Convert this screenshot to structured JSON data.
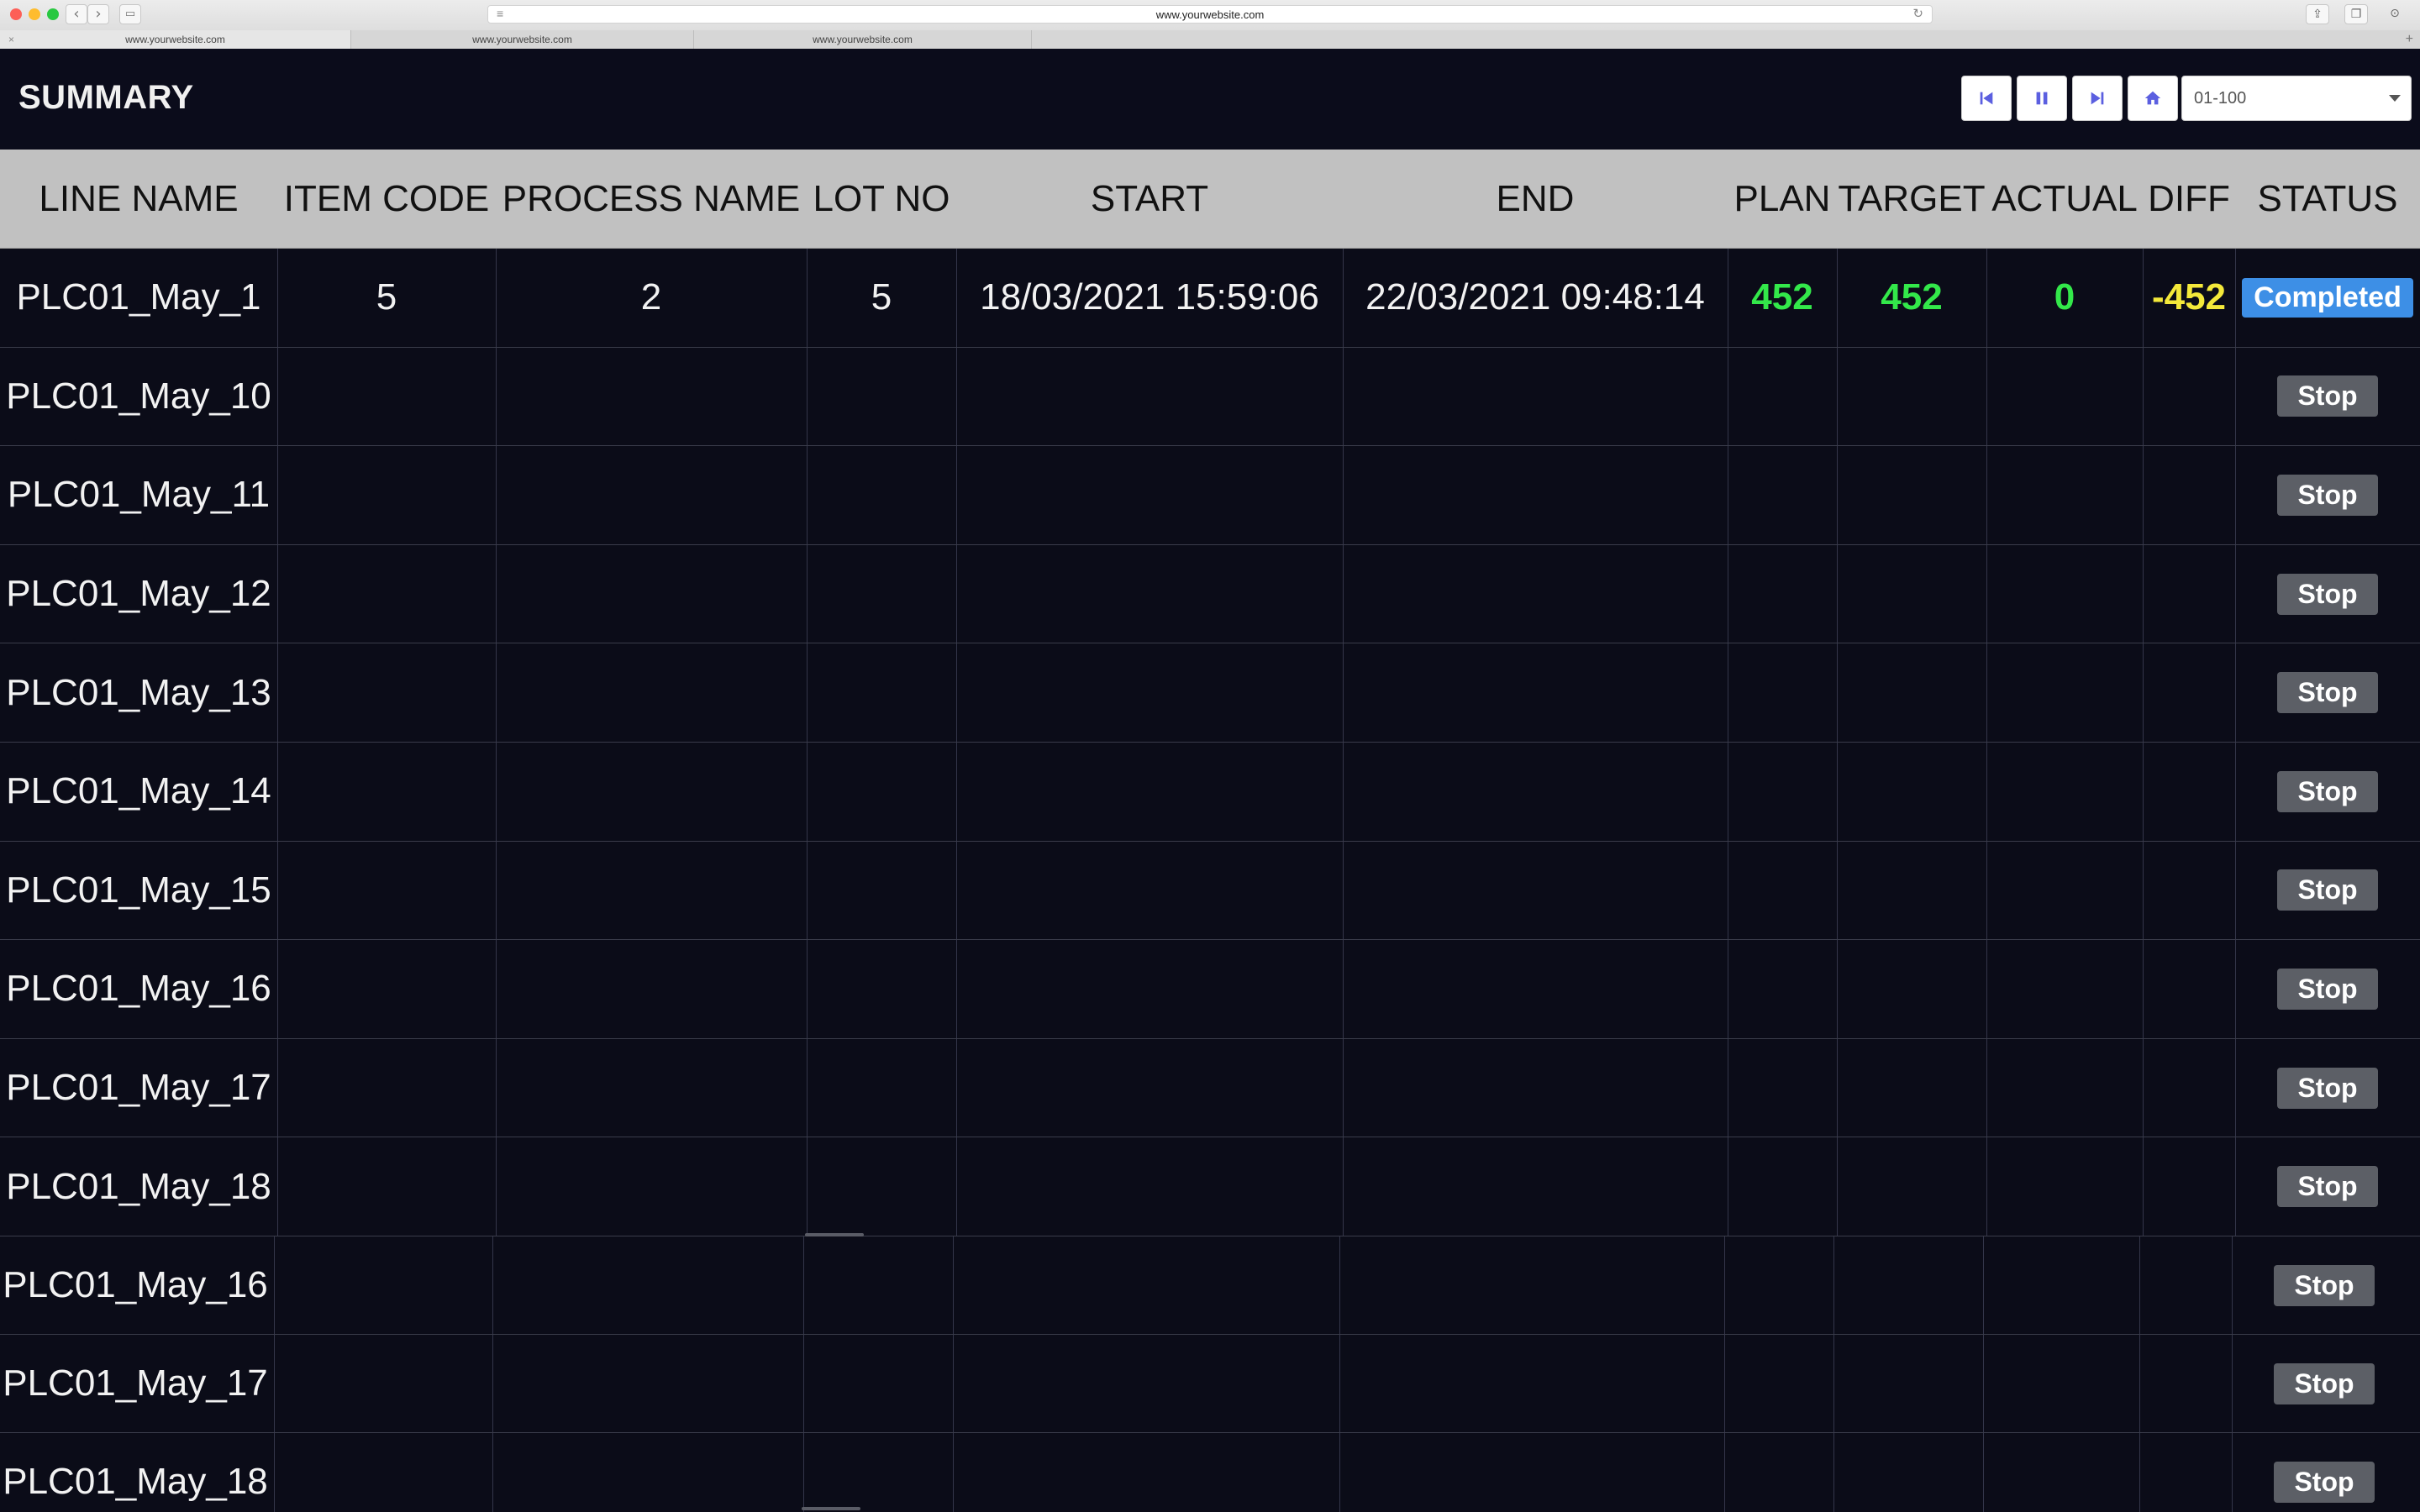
{
  "browser": {
    "url": "www.yourwebsite.com",
    "tabs": [
      "www.yourwebsite.com",
      "www.yourwebsite.com",
      "www.yourwebsite.com"
    ]
  },
  "header": {
    "title": "SUMMARY",
    "range_select": "01-100"
  },
  "table": {
    "columns": [
      "LINE NAME",
      "ITEM CODE",
      "PROCESS NAME",
      "LOT NO",
      "START",
      "END",
      "PLAN",
      "TARGET",
      "ACTUAL",
      "DIFF",
      "STATUS"
    ],
    "rows": [
      {
        "line": "PLC01_May_1",
        "item": "5",
        "process": "2",
        "lot": "5",
        "start": "18/03/2021 15:59:06",
        "end": "22/03/2021 09:48:14",
        "plan": "452",
        "target": "452",
        "actual": "0",
        "diff": "-452",
        "status": "Completed"
      },
      {
        "line": "PLC01_May_10",
        "status": "Stop"
      },
      {
        "line": "PLC01_May_11",
        "status": "Stop"
      },
      {
        "line": "PLC01_May_12",
        "status": "Stop"
      },
      {
        "line": "PLC01_May_13",
        "status": "Stop"
      },
      {
        "line": "PLC01_May_14",
        "status": "Stop"
      },
      {
        "line": "PLC01_May_15",
        "status": "Stop"
      },
      {
        "line": "PLC01_May_16",
        "status": "Stop"
      },
      {
        "line": "PLC01_May_17",
        "status": "Stop"
      },
      {
        "line": "PLC01_May_18",
        "status": "Stop"
      }
    ],
    "overflow_rows": [
      {
        "line": "PLC01_May_16",
        "status": "Stop"
      },
      {
        "line": "PLC01_May_17",
        "status": "Stop"
      },
      {
        "line": "PLC01_May_18",
        "status": "Stop"
      }
    ]
  },
  "colors": {
    "background": "#0b0c18",
    "header_bg": "#c1c1c1",
    "green": "#33e84a",
    "yellow": "#f4e93a",
    "completed": "#3d8fe6",
    "stop": "#5c5f66",
    "control_icon": "#5b5fe0"
  },
  "icons": {
    "first": "skip-back-icon",
    "pause": "pause-icon",
    "next": "skip-forward-icon",
    "home": "home-icon"
  }
}
